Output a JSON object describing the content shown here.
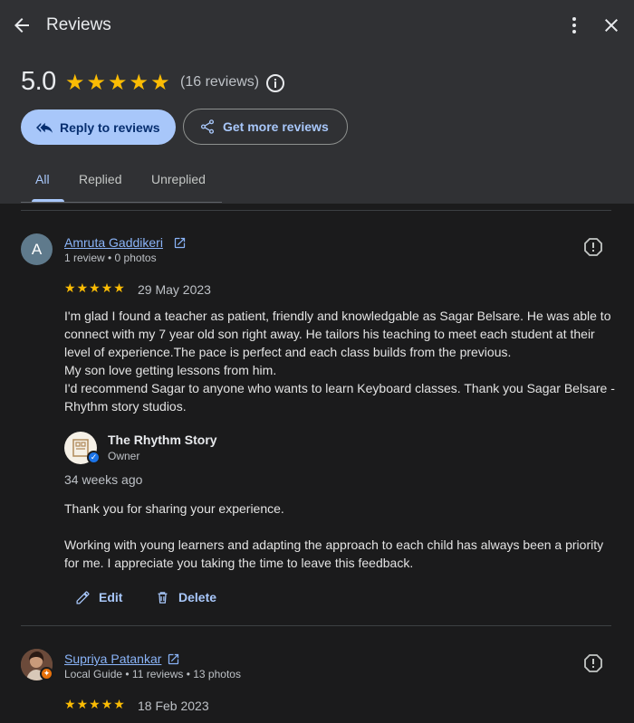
{
  "header": {
    "title": "Reviews",
    "back_icon": "arrow-back-icon",
    "more_icon": "more-vert-icon",
    "close_icon": "close-icon"
  },
  "summary": {
    "rating": "5.0",
    "stars": 5,
    "count_text": "(16 reviews)",
    "info_icon": "info-icon"
  },
  "buttons": {
    "reply_label": "Reply to reviews",
    "get_more_label": "Get more reviews"
  },
  "tabs": [
    {
      "label": "All",
      "active": true
    },
    {
      "label": "Replied",
      "active": false
    },
    {
      "label": "Unreplied",
      "active": false
    }
  ],
  "reviews": [
    {
      "avatar_letter": "A",
      "name": "Amruta Gaddikeri",
      "meta": "1 review • 0 photos",
      "stars": 5,
      "date": "29 May 2023",
      "body": "I'm glad I found a teacher as patient, friendly and knowledgable as Sagar Belsare. He was able to connect with my 7 year old son right away. He tailors his teaching to meet each student at their level of experience.The pace is perfect and each class builds from the previous.\nMy son love getting lessons from him.\nI'd recommend Sagar to anyone who wants to learn Keyboard classes. Thank you Sagar Belsare - Rhythm story studios.",
      "owner": {
        "name": "The Rhythm Story",
        "role": "Owner",
        "time": "34 weeks ago",
        "reply": "Thank you for sharing your experience.\n\nWorking with young learners and adapting the approach to each child has always been a priority for me. I appreciate you taking the time to leave this feedback."
      },
      "actions": {
        "edit": "Edit",
        "delete": "Delete"
      }
    },
    {
      "name": "Supriya Patankar",
      "meta": "Local Guide • 11 reviews • 13 photos",
      "stars": 5,
      "date": "18 Feb 2023"
    }
  ],
  "colors": {
    "accent": "#a8c7fa",
    "star": "#fbbc04",
    "header_bg": "#303134",
    "body_bg": "#1b1b1c"
  }
}
